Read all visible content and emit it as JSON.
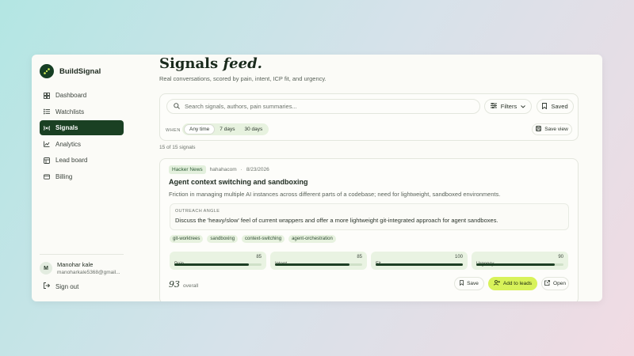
{
  "app": {
    "name": "BuildSignal"
  },
  "sidebar": {
    "items": [
      {
        "label": "Dashboard",
        "icon": "dashboard-icon",
        "active": false
      },
      {
        "label": "Watchlists",
        "icon": "list-icon",
        "active": false
      },
      {
        "label": "Signals",
        "icon": "radio-icon",
        "active": true
      },
      {
        "label": "Analytics",
        "icon": "chart-icon",
        "active": false
      },
      {
        "label": "Lead board",
        "icon": "board-icon",
        "active": false
      },
      {
        "label": "Billing",
        "icon": "card-icon",
        "active": false
      }
    ],
    "user": {
      "initial": "M",
      "name": "Manohar kale",
      "email": "manoharkale5368@gmail..."
    },
    "signout_label": "Sign out"
  },
  "header": {
    "title_main": "Signals",
    "title_italic": "feed.",
    "subtitle": "Real conversations, scored by pain, intent, ICP fit, and urgency."
  },
  "search": {
    "placeholder": "Search signals, authors, pain summaries...",
    "filters_label": "Filters",
    "saved_label": "Saved",
    "when_label": "WHEN",
    "time_options": [
      "Any time",
      "7 days",
      "30 days"
    ],
    "time_selected": "Any time",
    "save_view_label": "Save view"
  },
  "results": {
    "count_text": "15 of 15 signals"
  },
  "signal": {
    "source": "Hacker News",
    "author": "hahahacom",
    "separator": "·",
    "date": "8/23/2026",
    "title": "Agent context switching and sandboxing",
    "summary": "Friction in managing multiple AI instances across different parts of a codebase; need for lightweight, sandboxed environments.",
    "outreach_label": "OUTREACH ANGLE",
    "outreach_text": "Discuss the 'heavy/slow' feel of current wrappers and offer a more lightweight git-integrated approach for agent sandboxes.",
    "tags": [
      "git-worktrees",
      "sandboxing",
      "context-switching",
      "agent-orchestration"
    ],
    "metrics": [
      {
        "label": "Pain",
        "value": 85
      },
      {
        "label": "Intent",
        "value": 85
      },
      {
        "label": "Fit",
        "value": 100
      },
      {
        "label": "Urgency",
        "value": 90
      }
    ],
    "overall_score": "93",
    "overall_label": "overall",
    "save_label": "Save",
    "add_label": "Add to leads",
    "open_label": "Open"
  },
  "colors": {
    "accent_dark": "#1a4023",
    "accent_lime": "#d8f25a",
    "soft_green": "#e7f2df"
  }
}
